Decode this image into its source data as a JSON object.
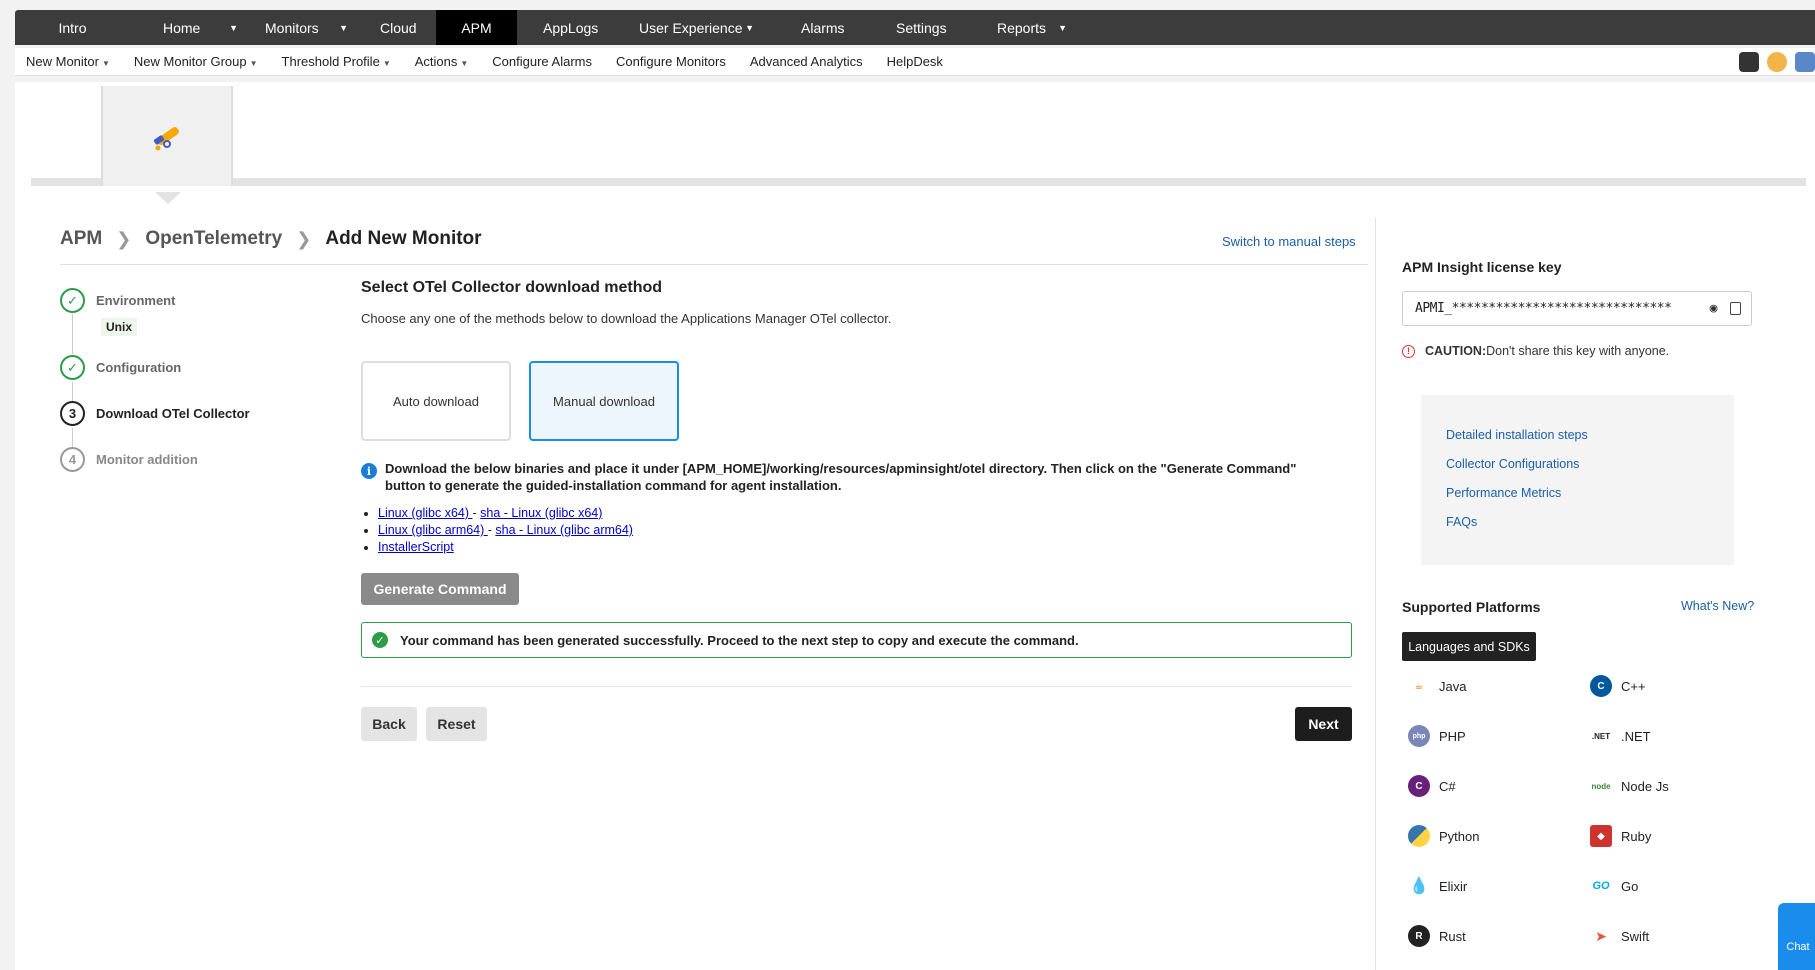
{
  "topnav": {
    "tabs": [
      {
        "label": "Intro"
      },
      {
        "label": "Home"
      },
      {
        "label": "Monitors"
      },
      {
        "label": "Cloud"
      },
      {
        "label": "APM"
      },
      {
        "label": "AppLogs"
      },
      {
        "label": "User Experience"
      },
      {
        "label": "Alarms"
      },
      {
        "label": "Settings"
      },
      {
        "label": "Reports"
      }
    ]
  },
  "subnav": {
    "items": [
      {
        "label": "New Monitor"
      },
      {
        "label": "New Monitor Group"
      },
      {
        "label": "Threshold Profile"
      },
      {
        "label": "Actions"
      },
      {
        "label": "Configure Alarms"
      },
      {
        "label": "Configure Monitors"
      },
      {
        "label": "Advanced Analytics"
      },
      {
        "label": "HelpDesk"
      }
    ]
  },
  "breadcrumb": {
    "items": [
      "APM",
      "OpenTelemetry",
      "Add New Monitor"
    ],
    "switch_link": "Switch to manual steps"
  },
  "stepper": {
    "steps": [
      {
        "label": "Environment",
        "tag": "Unix",
        "num": "1"
      },
      {
        "label": "Configuration",
        "num": "2"
      },
      {
        "label": "Download OTel Collector",
        "num": "3"
      },
      {
        "label": "Monitor addition",
        "num": "4"
      }
    ]
  },
  "main": {
    "heading": "Select OTel Collector download method",
    "description": "Choose any one of the methods below to download the Applications Manager OTel collector.",
    "options": [
      "Auto download",
      "Manual download"
    ],
    "info_text": "Download the below binaries and place it under [APM_HOME]/working/resources/apminsight/otel directory. Then click on the \"Generate Command\" button to generate the guided-installation command for agent installation.",
    "links": [
      {
        "a": "Linux (glibc x64) ",
        "b": "sha - Linux (glibc x64)"
      },
      {
        "a": "Linux (glibc arm64) ",
        "b": "sha - Linux (glibc arm64)"
      },
      {
        "a": "InstallerScript"
      }
    ],
    "link_sep": " - ",
    "generate_label": "Generate Command",
    "success_msg": "Your command has been generated successfully. Proceed to the next step to copy and execute the command.",
    "back_label": "Back",
    "reset_label": "Reset",
    "next_label": "Next"
  },
  "sidebar": {
    "license_title": "APM Insight license key",
    "license_value": "APMI_******************************",
    "caution_label": "CAUTION:",
    "caution_text": " Don't share this key with anyone.",
    "resources": [
      "Detailed installation steps",
      "Collector Configurations",
      "Performance Metrics",
      "FAQs"
    ],
    "platforms_title": "Supported Platforms",
    "whats_new": "What's New?",
    "lang_tab": "Languages and SDKs",
    "platforms": [
      {
        "name": "Java",
        "icon": "java-icon"
      },
      {
        "name": "C++",
        "icon": "cpp-icon"
      },
      {
        "name": "PHP",
        "icon": "php-icon"
      },
      {
        "name": ".NET",
        "icon": "dotnet-icon"
      },
      {
        "name": "C#",
        "icon": "csharp-icon"
      },
      {
        "name": "Node Js",
        "icon": "nodejs-icon"
      },
      {
        "name": "Python",
        "icon": "python-icon"
      },
      {
        "name": "Ruby",
        "icon": "ruby-icon"
      },
      {
        "name": "Elixir",
        "icon": "elixir-icon"
      },
      {
        "name": "Go",
        "icon": "go-icon"
      },
      {
        "name": "Rust",
        "icon": "rust-icon"
      },
      {
        "name": "Swift",
        "icon": "swift-icon"
      }
    ],
    "chat_label": "Chat"
  },
  "colors": {
    "accent_blue": "#1a8ceb",
    "success_green": "#2e9b4b",
    "link_blue": "#1a5fa6"
  }
}
